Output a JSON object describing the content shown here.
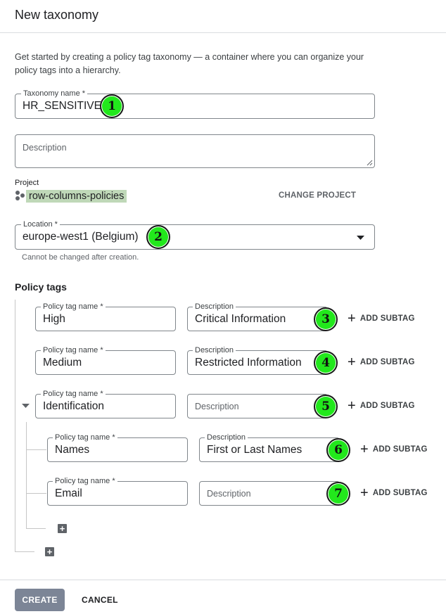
{
  "dialog": {
    "title": "New taxonomy",
    "intro": "Get started by creating a policy tag taxonomy — a container where you can organize your policy tags into a hierarchy."
  },
  "taxonomy_name": {
    "label": "Taxonomy name *",
    "value": "HR_SENSITIVE"
  },
  "description": {
    "placeholder": "Description"
  },
  "project": {
    "label": "Project",
    "value": "row-columns-policies",
    "change_label": "CHANGE PROJECT"
  },
  "location": {
    "label": "Location *",
    "value": "europe-west1 (Belgium)",
    "hint": "Cannot be changed after creation."
  },
  "policy_tags": {
    "heading": "Policy tags",
    "name_label": "Policy tag name *",
    "desc_label": "Description",
    "desc_placeholder": "Description",
    "add_subtag": "ADD SUBTAG",
    "tags": [
      {
        "name": "High",
        "description": "Critical Information",
        "badge": "3"
      },
      {
        "name": "Medium",
        "description": "Restricted Information",
        "badge": "4"
      },
      {
        "name": "Identification",
        "description": "",
        "badge": "5"
      },
      {
        "name": "Names",
        "description": "First or Last Names",
        "badge": "6"
      },
      {
        "name": "Email",
        "description": "",
        "badge": "7"
      }
    ]
  },
  "badges": {
    "b1": "1",
    "b2": "2"
  },
  "footer": {
    "create": "CREATE",
    "cancel": "CANCEL"
  },
  "colors": {
    "badge": "#22e81c",
    "highlight": "#bfd8b8",
    "create_bg": "#7c8596"
  },
  "icons": {
    "dropdown": "caret-down-icon",
    "project": "project-dots-icon",
    "expand": "triangle-down-icon",
    "add": "plus-icon",
    "add_tag": "square-plus-icon"
  }
}
